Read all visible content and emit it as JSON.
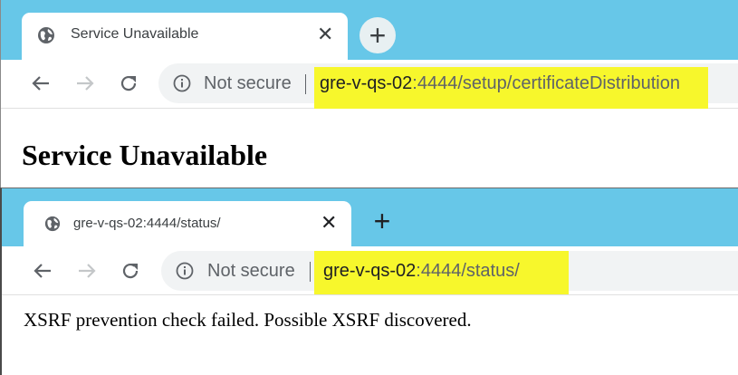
{
  "window1": {
    "tab_title": "Service Unavailable",
    "tab_close": "✕",
    "new_tab": "+",
    "security_label": "Not secure",
    "url_host": "gre-v-qs-02",
    "url_rest": ":4444/setup/certificateDistribution",
    "page_heading": "Service Unavailable"
  },
  "window2": {
    "tab_title": "gre-v-qs-02:4444/status/",
    "tab_close": "✕",
    "new_tab": "+",
    "security_label": "Not secure",
    "url_host": "gre-v-qs-02",
    "url_rest": ":4444/status/",
    "page_text": "XSRF prevention check failed. Possible XSRF discovered."
  },
  "colors": {
    "tabstrip": "#67c7e8",
    "highlight": "#f7f72c",
    "omnibox": "#f1f3f4"
  },
  "icons": [
    "globe-icon",
    "close-icon",
    "plus-icon",
    "back-arrow-icon",
    "forward-arrow-icon",
    "reload-icon",
    "info-icon"
  ]
}
